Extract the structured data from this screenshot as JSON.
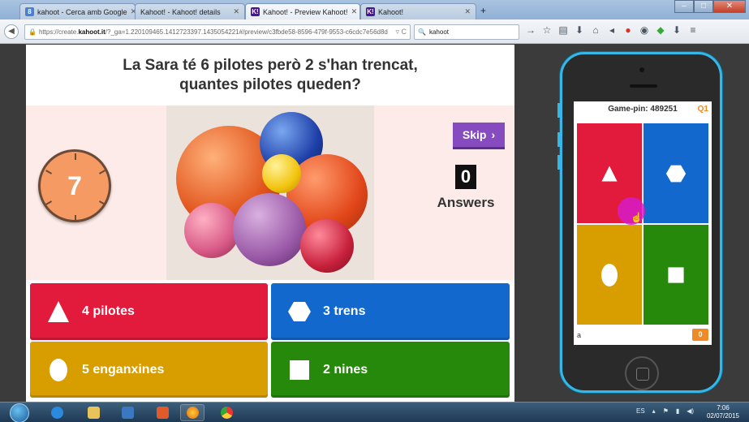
{
  "browser": {
    "tabs": [
      {
        "title": "kahoot - Cerca amb Google",
        "favicon": "google-icon",
        "color": "#4a7fd4"
      },
      {
        "title": "Kahoot! - Kahoot! details",
        "favicon": "kahoot-icon",
        "color": "#46178f"
      },
      {
        "title": "Kahoot! - Preview Kahoot!",
        "favicon": "kahoot-icon",
        "color": "#46178f"
      },
      {
        "title": "Kahoot!",
        "favicon": "kahoot-icon",
        "color": "#46178f"
      }
    ],
    "new_tab_label": "+",
    "url_prefix": "https://create.",
    "url_host": "kahoot.it",
    "url_path": "/?_ga=1.220109465.1412723397.1435054221#/preview/c3fbde58-8596-479f-9553-c6cdc7e56d8d",
    "search_value": "kahoot"
  },
  "game": {
    "question": "La Sara té 6 pilotes però 2 s'han trencat, quantes pilotes queden?",
    "timer": "7",
    "skip_label": "Skip",
    "answer_count": "0",
    "answers_label": "Answers",
    "answers": [
      {
        "text": "4 pilotes",
        "shape": "triangle",
        "color": "#e21b3c"
      },
      {
        "text": "3 trens",
        "shape": "hexagon",
        "color": "#1368ce"
      },
      {
        "text": "5 enganxines",
        "shape": "circle",
        "color": "#d89e00"
      },
      {
        "text": "2 nines",
        "shape": "square",
        "color": "#26890c"
      }
    ]
  },
  "phone": {
    "game_pin_label": "Game-pin: 489251",
    "question_number": "Q1",
    "nickname": "a",
    "score": "0"
  },
  "taskbar": {
    "language": "ES",
    "time": "7:06",
    "date": "02/07/2015"
  }
}
